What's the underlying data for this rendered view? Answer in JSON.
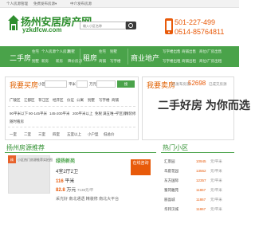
{
  "topbar": {
    "left": "个人房源管理",
    "mid": "免费发布房源",
    "mid_arrow": "▾",
    "right": "中介发布房源"
  },
  "header": {
    "site_name": "扬州安居房产网",
    "domain": "yzkdfcw.com",
    "search_placeholder": "输入小区名称",
    "phone1": "501-227-499",
    "phone2": "0514-85764811"
  },
  "nav": {
    "items": [
      {
        "big": "二手房",
        "small": [
          [
            "住宅",
            "个人房源"
          ],
          [
            "别墅",
            "新房"
          ]
        ]
      },
      {
        "big": "租房",
        "small": [
          [
            "住宅",
            "别墅"
          ],
          [
            "商铺",
            "写字楼"
          ]
        ]
      },
      {
        "big": "商业地产",
        "small": [
          [
            "写字楼出售",
            "商铺出售",
            "商位/厂房出售"
          ],
          [
            "写字楼出租",
            "商铺出租",
            "商位/厂房出租"
          ]
        ]
      }
    ],
    "extra": [
      [
        "个人房源",
        "别墅"
      ],
      [
        "新房",
        "降价房源"
      ]
    ]
  },
  "buy": {
    "title": "我要买房",
    "input_label": "小区",
    "unit1": "平米",
    "unit2": "万元",
    "price_label": "价格",
    "search_btn": "搜",
    "areas": [
      "广陵区",
      "江都区",
      "邗江区",
      "经开区",
      "仪征",
      "公寓",
      "别墅",
      "写字楼",
      "商铺"
    ],
    "sizes": [
      "90平米以下",
      "90-145平米",
      "145-200平米",
      "200平米以上",
      "免税",
      "满五唯一",
      "学区房",
      "精装修",
      "随时看房"
    ],
    "types": [
      "一室",
      "二室",
      "三室",
      "四室",
      "五室以上",
      "小户型",
      "低总价"
    ]
  },
  "sell": {
    "title": "我要卖房",
    "count_prefix": "已发布房源",
    "count": "52698",
    "count_suffix": "已成交房源",
    "slogan": "二手好房 为你而选"
  },
  "sections": {
    "recommend": "扬州房源推荐",
    "hot_area": "热门小区"
  },
  "listing": {
    "hot_badge": "精",
    "thumb_caption": "小区热门房源推荐实拍图",
    "title": "绿扬新苑",
    "layout": "4室2厅2卫",
    "area_label": "平米",
    "area": "116",
    "price_label": "万元",
    "price": "82.8",
    "unit_price": "7138元/平",
    "tags": "采光好 南北通透 精装修 南北大平台",
    "btn": "在线咨询"
  },
  "hot": [
    {
      "name": "汇景园",
      "price": "10945",
      "unit": "元/平米"
    },
    {
      "name": "华庭花园",
      "price": "13562",
      "unit": "元/平米"
    },
    {
      "name": "东方国际",
      "price": "12357",
      "unit": "元/平米"
    },
    {
      "name": "蜀冈雅苑",
      "price": "11867",
      "unit": "元/平米"
    },
    {
      "name": "丽晶城",
      "price": "11867",
      "unit": "元/平米"
    },
    {
      "name": "华邦汉城",
      "price": "11867",
      "unit": "元/平米"
    }
  ]
}
